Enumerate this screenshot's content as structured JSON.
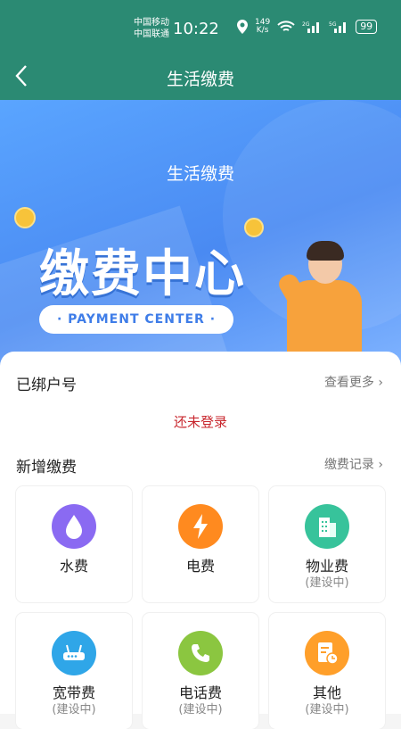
{
  "status_bar": {
    "carrier1": "中国移动",
    "carrier2": "中国联通",
    "time": "10:22",
    "speed_value": "149",
    "speed_unit": "K/s",
    "battery": "99"
  },
  "nav": {
    "title": "生活缴费"
  },
  "banner": {
    "subtitle": "生活缴费",
    "main_title": "缴费中心",
    "pill_text": "· PAYMENT CENTER ·"
  },
  "bound": {
    "title": "已绑户号",
    "more": "查看更多",
    "empty_text": "还未登录"
  },
  "new_payment": {
    "title": "新增缴费",
    "history": "缴费记录",
    "items": [
      {
        "label": "水费",
        "sub": "",
        "icon": "water-drop-icon",
        "color": "#8a6af2"
      },
      {
        "label": "电费",
        "sub": "",
        "icon": "lightning-icon",
        "color": "#ff8a1f"
      },
      {
        "label": "物业费",
        "sub": "(建设中)",
        "icon": "building-icon",
        "color": "#37c39b"
      },
      {
        "label": "宽带费",
        "sub": "(建设中)",
        "icon": "router-icon",
        "color": "#2fa6e8"
      },
      {
        "label": "电话费",
        "sub": "(建设中)",
        "icon": "phone-icon",
        "color": "#8bc640"
      },
      {
        "label": "其他",
        "sub": "(建设中)",
        "icon": "document-clock-icon",
        "color": "#ff9f2a"
      }
    ]
  }
}
